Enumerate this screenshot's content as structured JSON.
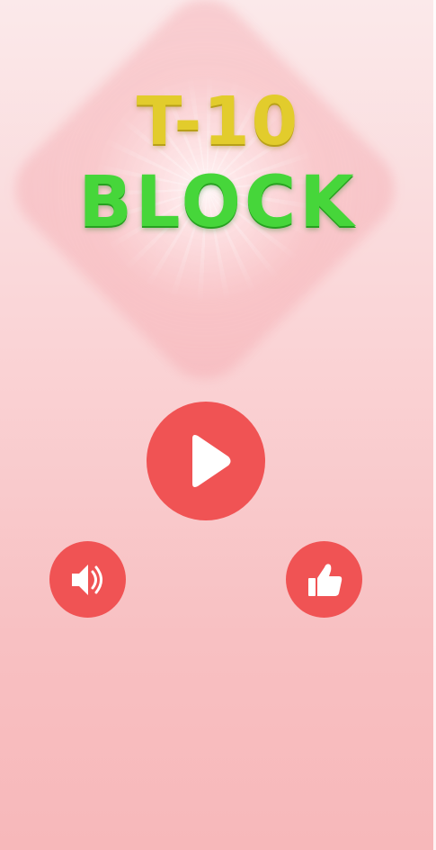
{
  "game": {
    "logo": {
      "line1": "T-10",
      "line2": "BLOCK"
    },
    "buttons": {
      "play": {
        "icon": "play-icon"
      },
      "sound": {
        "icon": "speaker-icon"
      },
      "like": {
        "icon": "thumbs-up-icon"
      }
    },
    "colors": {
      "button": "#f05354",
      "title_line1": "#e2cc2c",
      "title_line2": "#46d63a",
      "background_top": "#fbe9ea",
      "background_bottom": "#f7b8ba"
    }
  }
}
